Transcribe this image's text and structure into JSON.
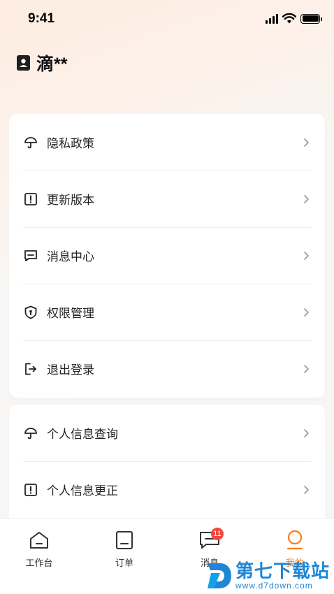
{
  "status_bar": {
    "time": "9:41"
  },
  "user": {
    "name": "滴**"
  },
  "menu_group_1": [
    {
      "label": "隐私政策",
      "icon": "umbrella-icon"
    },
    {
      "label": "更新版本",
      "icon": "alert-square-icon"
    },
    {
      "label": "消息中心",
      "icon": "message-icon"
    },
    {
      "label": "权限管理",
      "icon": "shield-lock-icon"
    },
    {
      "label": "退出登录",
      "icon": "logout-icon"
    }
  ],
  "menu_group_2": [
    {
      "label": "个人信息查询",
      "icon": "umbrella-icon"
    },
    {
      "label": "个人信息更正",
      "icon": "alert-square-icon"
    }
  ],
  "tab_bar": {
    "items": [
      {
        "label": "工作台",
        "icon": "home-icon"
      },
      {
        "label": "订单",
        "icon": "order-icon"
      },
      {
        "label": "消息",
        "icon": "message-icon",
        "badge": "11"
      },
      {
        "label": "我的",
        "icon": "profile-icon",
        "active": true
      }
    ],
    "active_color": "#ff7a1a"
  },
  "watermark": {
    "title": "第七下载站",
    "url": "www.d7down.com"
  }
}
